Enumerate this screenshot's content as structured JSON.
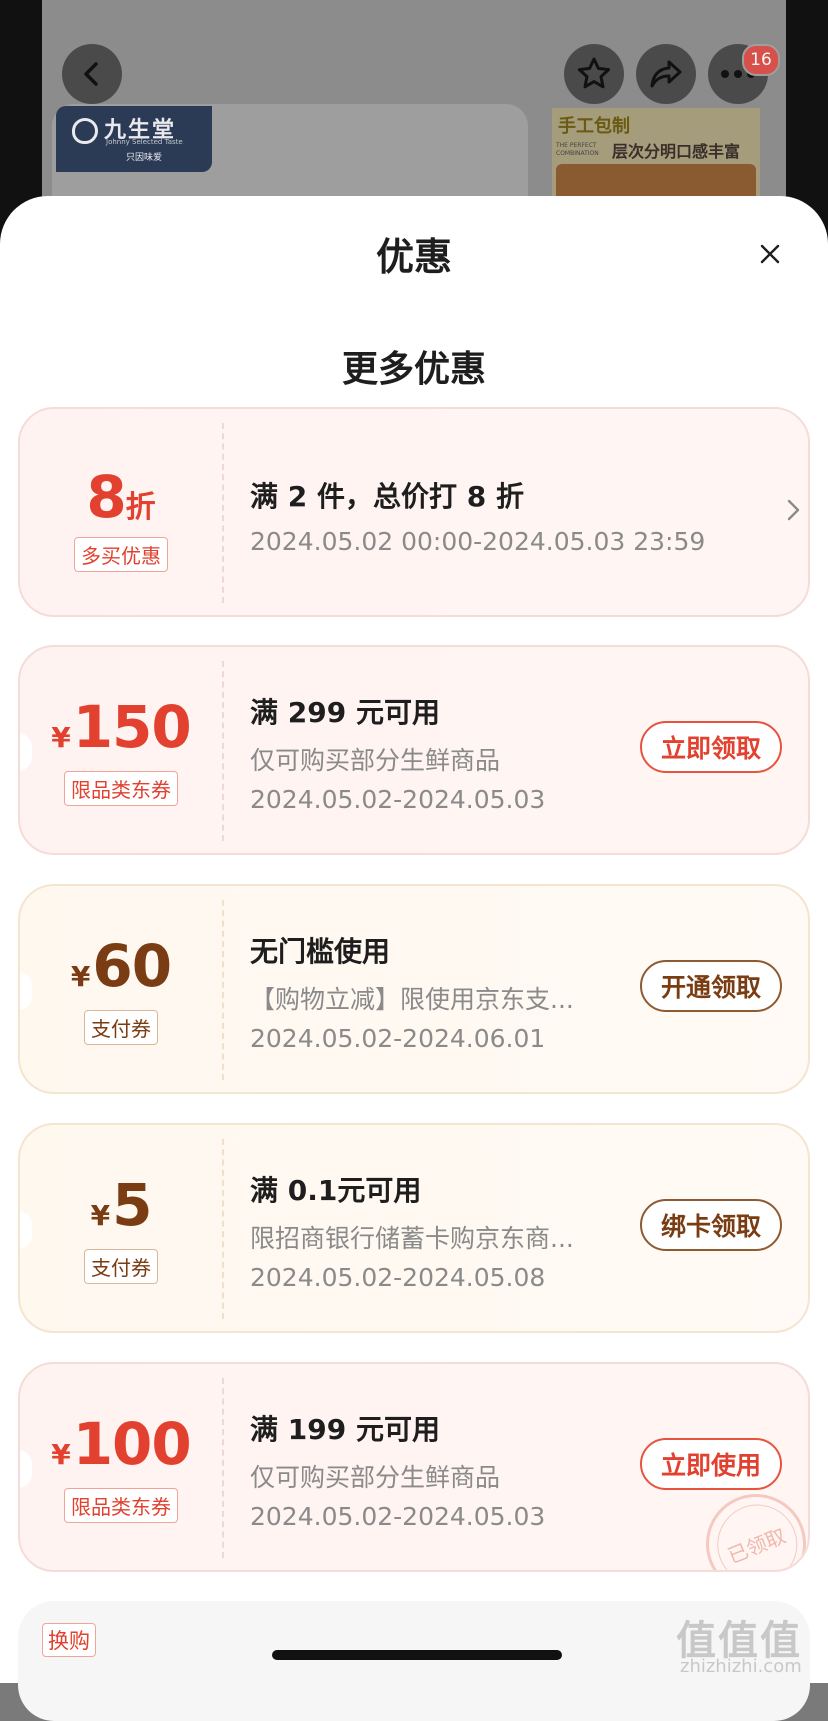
{
  "background": {
    "brand_cn": "九生堂",
    "brand_en": "Johnny Selected Taste",
    "brand_sub": "只因味爱",
    "promo_title": "手工包制",
    "promo_sub": "层次分明口感丰富",
    "promo_en": "THE PERFECT COMBINATION",
    "cart_badge": "16",
    "icons": [
      "back-icon",
      "favorite-star-icon",
      "share-icon",
      "more-icon"
    ]
  },
  "sheet": {
    "title": "优惠",
    "section_title": "更多优惠",
    "close_icon": "close-icon"
  },
  "coupons": [
    {
      "amount": "8",
      "unit": "折",
      "tag": "多买优惠",
      "line1": "满 2 件，总价打 8 折",
      "line2": "2024.05.02 00:00-2024.05.03 23:59",
      "theme_color": "#e2412f"
    },
    {
      "currency": "¥",
      "amount": "150",
      "tag": "限品类东券",
      "line1": "满 299 元可用",
      "line2": "仅可购买部分生鲜商品",
      "line3": "2024.05.02-2024.05.03",
      "button": "立即领取",
      "theme_color": "#e2412f"
    },
    {
      "currency": "¥",
      "amount": "60",
      "tag": "支付券",
      "line1": "无门槛使用",
      "line2": "【购物立减】限使用京东支...",
      "line3": "2024.05.02-2024.06.01",
      "button": "开通领取",
      "theme_color": "#7a3c12"
    },
    {
      "currency": "¥",
      "amount": "5",
      "tag": "支付券",
      "line1": "满 0.1元可用",
      "line2": "限招商银行储蓄卡购京东商...",
      "line3": "2024.05.02-2024.05.08",
      "button": "绑卡领取",
      "theme_color": "#7a3c12"
    },
    {
      "currency": "¥",
      "amount": "100",
      "tag": "限品类东券",
      "line1": "满 199 元可用",
      "line2": "仅可购买部分生鲜商品",
      "line3": "2024.05.02-2024.05.03",
      "button": "立即使用",
      "stamp": "已领取",
      "theme_color": "#e2412f"
    }
  ],
  "last_card": {
    "tag": "换购"
  },
  "watermark": {
    "text": "值值值",
    "domain": "zhizhizhi.com"
  }
}
